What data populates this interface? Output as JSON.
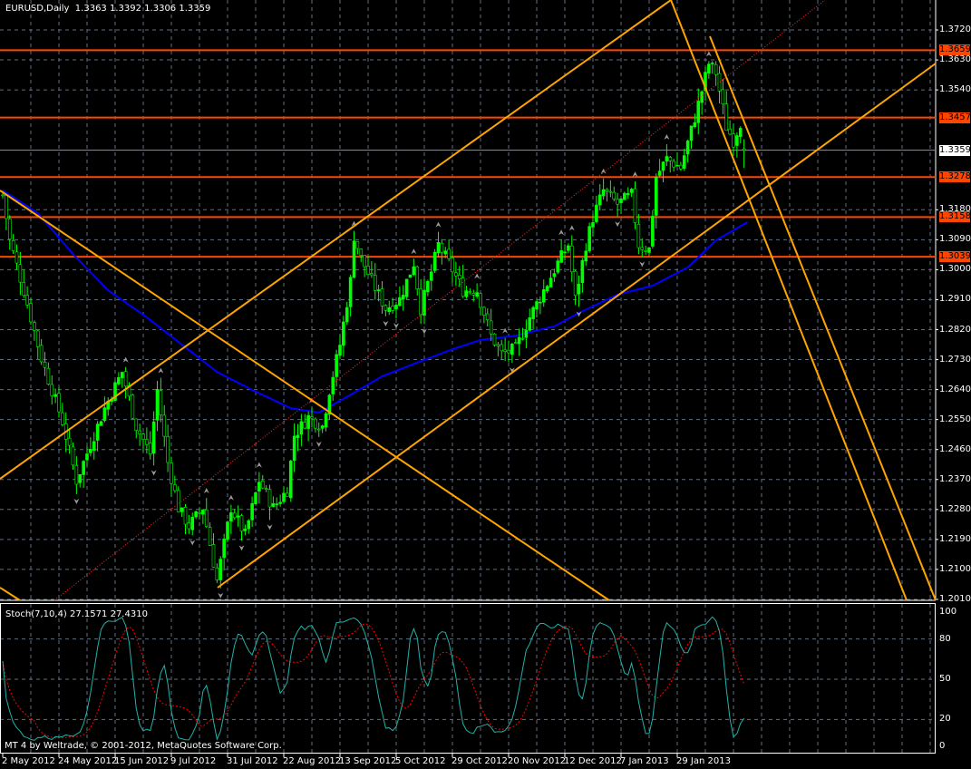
{
  "header": {
    "symbol_timeframe": "EURUSD,Daily",
    "open": "1.3363",
    "high": "1.3392",
    "low": "1.3306",
    "close": "1.3359"
  },
  "indicator": {
    "label": "Stoch(7,10,4)",
    "main": "27.1571",
    "signal": "27.4310",
    "levels": [
      "100",
      "80",
      "50",
      "20",
      "0"
    ]
  },
  "copyright": "MT 4 by Weltrade, © 2001-2012, MetaQuotes Software Corp.",
  "colors": {
    "bull": "#00ff00",
    "ma": "#0000ff",
    "trend": "#ffa500",
    "hline": "#ff4500",
    "stoch_main": "#20b2aa",
    "stoch_signal": "#ff0000",
    "grid": "#5f6e7f"
  },
  "chart_data": {
    "type": "candlestick",
    "title": "EURUSD,Daily",
    "price_ticks": [
      "1.3720",
      "1.3630",
      "1.3540",
      "1.3180",
      "1.3090",
      "1.3000",
      "1.2910",
      "1.2820",
      "1.2730",
      "1.2640",
      "1.2550",
      "1.2460",
      "1.2370",
      "1.2280",
      "1.2190",
      "1.2100",
      "1.2010"
    ],
    "ylim": [
      1.201,
      1.372
    ],
    "date_ticks": [
      "2 May 2012",
      "24 May 2012",
      "15 Jun 2012",
      "9 Jul 2012",
      "31 Jul 2012",
      "22 Aug 2012",
      "13 Sep 2012",
      "5 Oct 2012",
      "29 Oct 2012",
      "20 Nov 2012",
      "12 Dec 2012",
      "7 Jan 2013",
      "29 Jan 2013"
    ],
    "bars_per_date_tick": 16,
    "horizontal_levels": [
      "1.3659",
      "1.3457",
      "1.3278",
      "1.3158",
      "1.3039"
    ],
    "bid": "1.3359",
    "close_waypoints": [
      [
        0,
        1.3224
      ],
      [
        2,
        1.3088
      ],
      [
        6,
        1.2938
      ],
      [
        11,
        1.2734
      ],
      [
        17,
        1.2544
      ],
      [
        21,
        1.2367
      ],
      [
        25,
        1.2476
      ],
      [
        29,
        1.2584
      ],
      [
        34,
        1.2693
      ],
      [
        38,
        1.253
      ],
      [
        42,
        1.2448
      ],
      [
        44,
        1.2639
      ],
      [
        47,
        1.2421
      ],
      [
        50,
        1.2285
      ],
      [
        53,
        1.223
      ],
      [
        57,
        1.2285
      ],
      [
        61,
        1.2067
      ],
      [
        65,
        1.2285
      ],
      [
        69,
        1.2203
      ],
      [
        73,
        1.2367
      ],
      [
        77,
        1.2285
      ],
      [
        81,
        1.2339
      ],
      [
        83,
        1.2503
      ],
      [
        87,
        1.2557
      ],
      [
        91,
        1.253
      ],
      [
        93,
        1.2639
      ],
      [
        96,
        1.2775
      ],
      [
        99,
        1.2966
      ],
      [
        100,
        1.3102
      ],
      [
        102,
        1.3034
      ],
      [
        105,
        1.2966
      ],
      [
        109,
        1.2884
      ],
      [
        113,
        1.2911
      ],
      [
        117,
        1.302
      ],
      [
        119,
        1.2884
      ],
      [
        122,
        1.2993
      ],
      [
        124,
        1.3075
      ],
      [
        127,
        1.302
      ],
      [
        131,
        1.2938
      ],
      [
        135,
        1.2938
      ],
      [
        139,
        1.2802
      ],
      [
        142,
        1.2748
      ],
      [
        146,
        1.2761
      ],
      [
        150,
        1.2857
      ],
      [
        154,
        1.2938
      ],
      [
        158,
        1.302
      ],
      [
        161,
        1.3075
      ],
      [
        163,
        1.2911
      ],
      [
        166,
        1.3075
      ],
      [
        168,
        1.3156
      ],
      [
        171,
        1.3238
      ],
      [
        175,
        1.3197
      ],
      [
        179,
        1.3224
      ],
      [
        181,
        1.3075
      ],
      [
        184,
        1.3061
      ],
      [
        186,
        1.3279
      ],
      [
        189,
        1.3333
      ],
      [
        193,
        1.3306
      ],
      [
        197,
        1.3456
      ],
      [
        201,
        1.3619
      ],
      [
        203,
        1.3592
      ],
      [
        206,
        1.3429
      ],
      [
        208,
        1.3388
      ],
      [
        210,
        1.3442
      ],
      [
        211,
        1.3359
      ]
    ],
    "ma_waypoints": [
      [
        0,
        1.3238
      ],
      [
        10,
        1.317
      ],
      [
        20,
        1.3047
      ],
      [
        30,
        1.2938
      ],
      [
        41,
        1.2857
      ],
      [
        51,
        1.2775
      ],
      [
        61,
        1.2693
      ],
      [
        71,
        1.2639
      ],
      [
        82,
        1.2584
      ],
      [
        90,
        1.2571
      ],
      [
        97,
        1.2612
      ],
      [
        108,
        1.268
      ],
      [
        118,
        1.2721
      ],
      [
        128,
        1.2761
      ],
      [
        136,
        1.2789
      ],
      [
        146,
        1.2802
      ],
      [
        157,
        1.283
      ],
      [
        164,
        1.287
      ],
      [
        175,
        1.2925
      ],
      [
        185,
        1.2952
      ],
      [
        195,
        1.3007
      ],
      [
        203,
        1.3088
      ],
      [
        212,
        1.3143
      ]
    ],
    "stoch": {
      "k": 7,
      "d": 10,
      "slowing": 4,
      "ylim": [
        0,
        100
      ],
      "levels": [
        20,
        50,
        80
      ]
    }
  }
}
